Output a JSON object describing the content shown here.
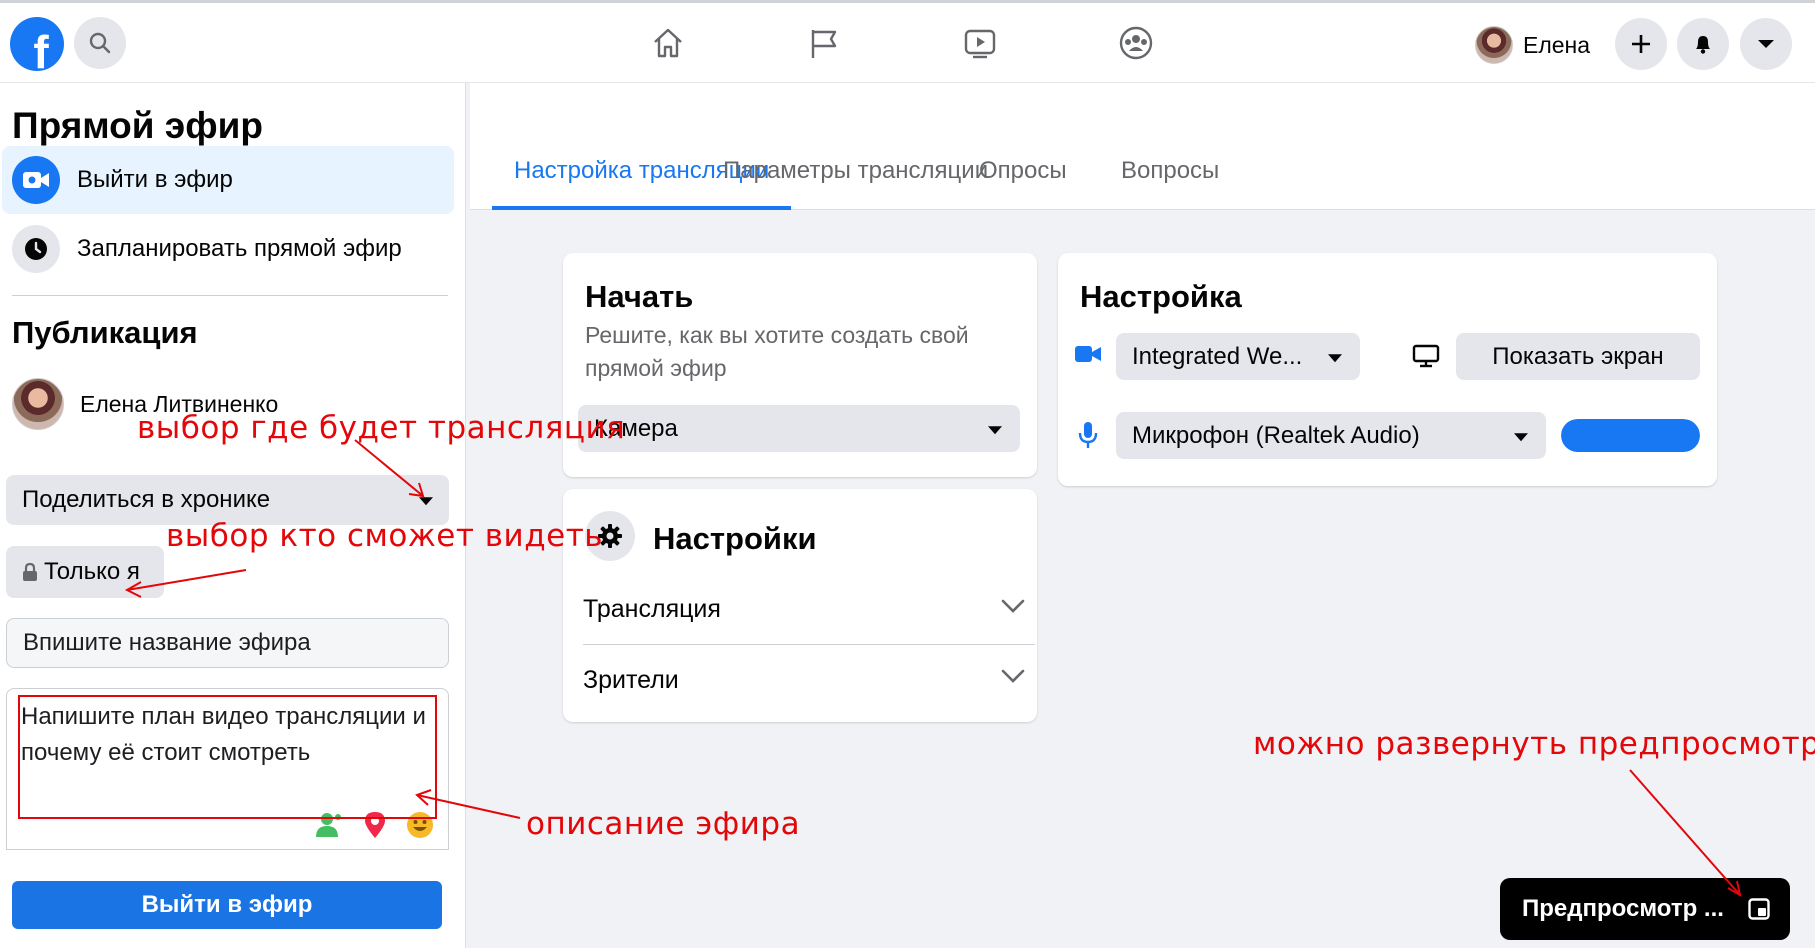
{
  "topbar": {
    "logo_letter": "f",
    "user_name": "Елена"
  },
  "sidebar": {
    "title": "Прямой эфир",
    "items": [
      {
        "label": "Выйти в эфир"
      },
      {
        "label": "Запланировать прямой эфир"
      }
    ],
    "publication_title": "Публикация",
    "profile_name": "Елена Литвиненко",
    "share_select": "Поделиться в хронике",
    "privacy_label": "Только я",
    "title_placeholder": "Впишите название эфира",
    "description_text": "Напишите план видео трансляции и почему её стоит смотреть",
    "go_live_button": "Выйти в эфир"
  },
  "tabs": [
    {
      "label": "Настройка трансляции",
      "active": true
    },
    {
      "label": "Параметры трансляции",
      "active": false
    },
    {
      "label": "Опросы",
      "active": false
    },
    {
      "label": "Вопросы",
      "active": false
    }
  ],
  "start_card": {
    "title": "Начать",
    "subtitle": "Решите, как вы хотите создать свой прямой эфир",
    "source_select": "Камера"
  },
  "settings_card": {
    "title": "Настройки",
    "rows": [
      {
        "label": "Трансляция"
      },
      {
        "label": "Зрители"
      }
    ]
  },
  "setup_card": {
    "title": "Настройка",
    "camera_select": "Integrated We...",
    "share_screen_button": "Показать экран",
    "mic_select": "Микрофон (Realtek Audio)",
    "mic_level_fraction": 1.0
  },
  "preview": {
    "label": "Предпросмотр ..."
  },
  "annotations": {
    "where": "выбор где будет трансляция",
    "who": "выбор кто сможет видеть",
    "description": "описание эфира",
    "preview": "можно развернуть предпросмотр"
  },
  "colors": {
    "brand": "#1877f2",
    "annotation_red": "#e3070a",
    "button_bg": "#e4e6eb"
  }
}
